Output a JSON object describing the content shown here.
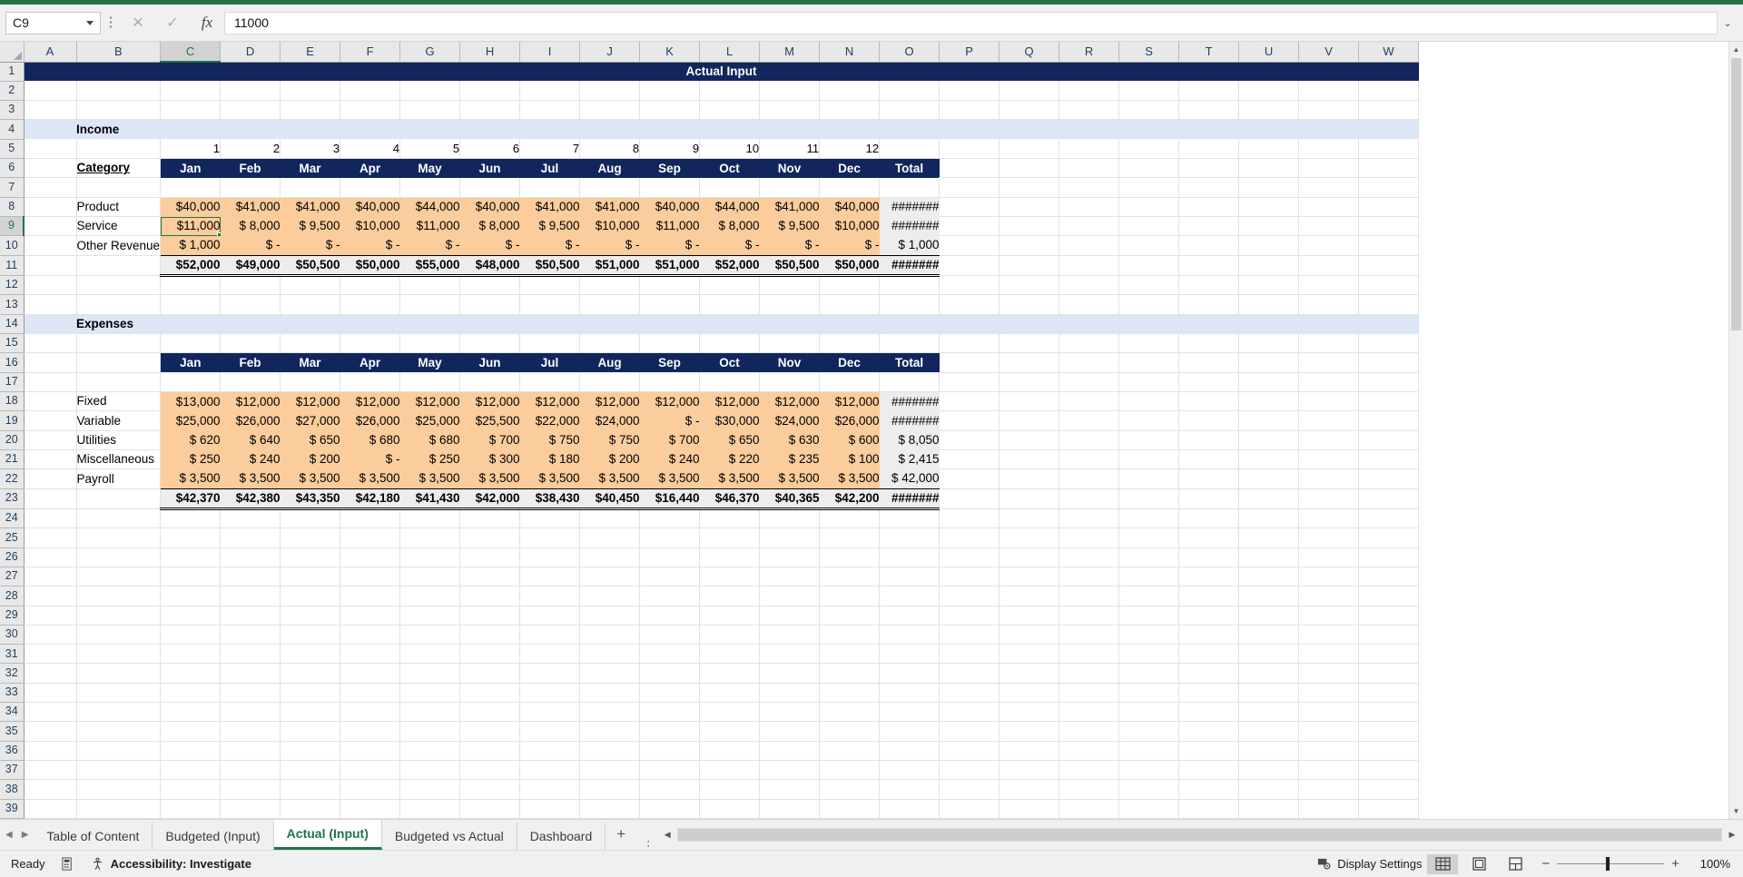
{
  "namebox": {
    "value": "C9"
  },
  "formula_bar": {
    "value": "11000",
    "cancel_icon": "close-icon",
    "confirm_icon": "check-icon",
    "fx_label": "fx"
  },
  "columns": [
    "A",
    "B",
    "C",
    "D",
    "E",
    "F",
    "G",
    "H",
    "I",
    "J",
    "K",
    "L",
    "M",
    "N",
    "O",
    "P",
    "Q",
    "R",
    "S",
    "T",
    "U",
    "V",
    "W"
  ],
  "selected_column": "C",
  "selected_row": 9,
  "rows_visible": [
    1,
    2,
    3,
    4,
    5,
    6,
    7,
    8,
    9,
    10,
    11,
    12,
    13,
    14,
    15,
    16,
    17,
    18,
    19,
    20,
    21,
    22,
    23,
    24,
    25,
    26,
    27,
    28,
    29,
    30,
    31,
    32,
    33,
    34,
    35,
    36,
    37,
    38,
    39
  ],
  "sheet": {
    "title": "Actual Input",
    "income": {
      "section_label": "Income",
      "category_header": "Category",
      "month_numbers": [
        "1",
        "2",
        "3",
        "4",
        "5",
        "6",
        "7",
        "8",
        "9",
        "10",
        "11",
        "12"
      ],
      "month_names": [
        "Jan",
        "Feb",
        "Mar",
        "Apr",
        "May",
        "Jun",
        "Jul",
        "Aug",
        "Sep",
        "Oct",
        "Nov",
        "Dec"
      ],
      "total_header": "Total",
      "rows": [
        {
          "label": "Product",
          "values": [
            "$40,000",
            "$41,000",
            "$41,000",
            "$40,000",
            "$44,000",
            "$40,000",
            "$41,000",
            "$41,000",
            "$40,000",
            "$44,000",
            "$41,000",
            "$40,000"
          ],
          "total": "#######"
        },
        {
          "label": "Service",
          "values": [
            "$11,000",
            "$  8,000",
            "$  9,500",
            "$10,000",
            "$11,000",
            "$  8,000",
            "$  9,500",
            "$10,000",
            "$11,000",
            "$  8,000",
            "$  9,500",
            "$10,000"
          ],
          "total": "#######"
        },
        {
          "label": "Other Revenue",
          "values": [
            "$  1,000",
            "$        -",
            "$        -",
            "$        -",
            "$        -",
            "$        -",
            "$        -",
            "$        -",
            "$        -",
            "$        -",
            "$        -",
            "$        -"
          ],
          "total": "$   1,000"
        }
      ],
      "totals": {
        "values": [
          "$52,000",
          "$49,000",
          "$50,500",
          "$50,000",
          "$55,000",
          "$48,000",
          "$50,500",
          "$51,000",
          "$51,000",
          "$52,000",
          "$50,500",
          "$50,000"
        ],
        "total": "#######"
      }
    },
    "expenses": {
      "section_label": "Expenses",
      "month_names": [
        "Jan",
        "Feb",
        "Mar",
        "Apr",
        "May",
        "Jun",
        "Jul",
        "Aug",
        "Sep",
        "Oct",
        "Nov",
        "Dec"
      ],
      "total_header": "Total",
      "rows": [
        {
          "label": "Fixed",
          "values": [
            "$13,000",
            "$12,000",
            "$12,000",
            "$12,000",
            "$12,000",
            "$12,000",
            "$12,000",
            "$12,000",
            "$12,000",
            "$12,000",
            "$12,000",
            "$12,000"
          ],
          "total": "#######"
        },
        {
          "label": "Variable",
          "values": [
            "$25,000",
            "$26,000",
            "$27,000",
            "$26,000",
            "$25,000",
            "$25,500",
            "$22,000",
            "$24,000",
            "$        -",
            "$30,000",
            "$24,000",
            "$26,000"
          ],
          "total": "#######"
        },
        {
          "label": "Utilities",
          "values": [
            "$     620",
            "$     640",
            "$     650",
            "$     680",
            "$     680",
            "$     700",
            "$     750",
            "$     750",
            "$     700",
            "$     650",
            "$     630",
            "$     600"
          ],
          "total": "$   8,050"
        },
        {
          "label": "Miscellaneous",
          "values": [
            "$     250",
            "$     240",
            "$     200",
            "$        -",
            "$     250",
            "$     300",
            "$     180",
            "$     200",
            "$     240",
            "$     220",
            "$     235",
            "$     100"
          ],
          "total": "$   2,415"
        },
        {
          "label": "Payroll",
          "values": [
            "$  3,500",
            "$  3,500",
            "$  3,500",
            "$  3,500",
            "$  3,500",
            "$  3,500",
            "$  3,500",
            "$  3,500",
            "$  3,500",
            "$  3,500",
            "$  3,500",
            "$  3,500"
          ],
          "total": "$ 42,000"
        }
      ],
      "totals": {
        "values": [
          "$42,370",
          "$42,380",
          "$43,350",
          "$42,180",
          "$41,430",
          "$42,000",
          "$38,430",
          "$40,450",
          "$16,440",
          "$46,370",
          "$40,365",
          "$42,200"
        ],
        "total": "#######"
      }
    }
  },
  "sheet_tabs": {
    "items": [
      {
        "label": "Table of Content",
        "active": false
      },
      {
        "label": "Budgeted (Input)",
        "active": false
      },
      {
        "label": "Actual (Input)",
        "active": true
      },
      {
        "label": "Budgeted vs Actual",
        "active": false
      },
      {
        "label": "Dashboard",
        "active": false
      }
    ],
    "add_sheet_label": "+"
  },
  "status_bar": {
    "ready_label": "Ready",
    "accessibility_label": "Accessibility: Investigate",
    "display_settings_label": "Display Settings",
    "zoom_level": "100%",
    "zoom_out": "−",
    "zoom_in": "+"
  },
  "colors": {
    "accent_green": "#217346",
    "header_navy": "#10265c",
    "input_orange": "#fbcc9c",
    "banner_blue": "#dce6f7",
    "total_grey": "#ededed"
  }
}
